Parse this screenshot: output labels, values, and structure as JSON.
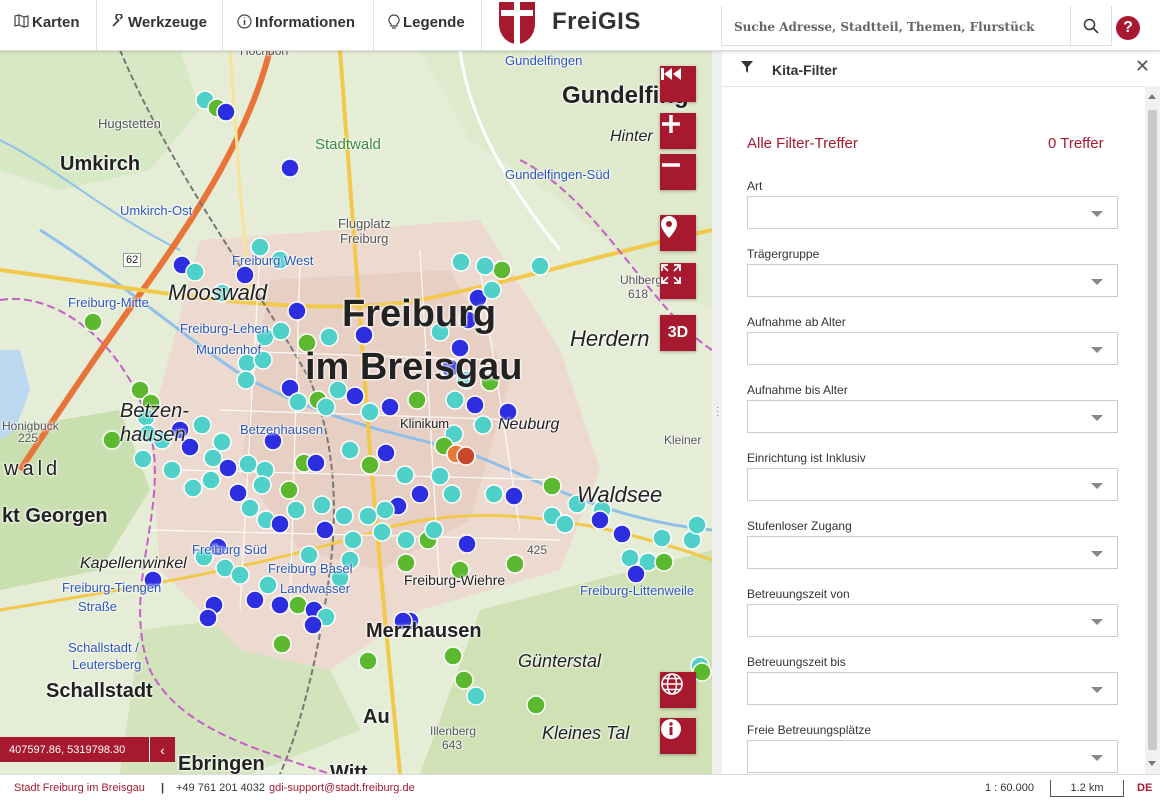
{
  "nav": {
    "karten": "Karten",
    "werkzeuge": "Werkzeuge",
    "informationen": "Informationen",
    "legende": "Legende",
    "app_title": "FreiGIS",
    "search_placeholder": "Suche Adresse, Stadtteil, Themen, Flurstück",
    "icons": {
      "karten": "map-icon",
      "werkzeuge": "wrench-icon",
      "informationen": "info-icon",
      "legende": "lightbulb-icon",
      "search": "search-icon",
      "help": "question-icon"
    }
  },
  "map": {
    "labels": {
      "hochdorf": "Hochdorf",
      "hugstetten": "Hugstetten",
      "umkirch": "Umkirch",
      "stadtwald": "Stadtwald",
      "umkirch_ost": "Umkirch-Ost",
      "flugplatz1": "Flugplatz",
      "flugplatz2": "Freiburg",
      "freiburg_west": "Freiburg West",
      "road62": "62",
      "freiburg_mitte": "Freiburg-Mitte",
      "mooswald": "Mooswald",
      "freiburg1": "Freiburg",
      "freiburg2": "im Breisgau",
      "herdern": "Herdern",
      "freiburg_lehen": "Freiburg-Lehen",
      "mundenhof": "Mundenhof",
      "betzen1": "Betzen-",
      "betzen2": "hausen",
      "betzenhausen": "Betzenhausen",
      "honigbuck": "Honigbuck",
      "h225": "225",
      "wald": "wald",
      "st_georgen": "kt Georgen",
      "kapellenwinkel": "Kapellenwinkel",
      "tiengen1": "Freiburg-Tiengen",
      "tiengen2": "Straße",
      "schallstadt_st1": "Schallstadt /",
      "schallstadt_st2": "Leutersberg",
      "schallstadt": "Schallstadt",
      "merzhausen": "Merzhausen",
      "au": "Au",
      "freiburg_wiehre": "Freiburg-Wiehre",
      "waldsee": "Waldsee",
      "guntersral": "Günterstal",
      "kleines_tal": "Kleines Tal",
      "illenberg": "Illenberg",
      "h643": "643",
      "gundelfingen_st": "Gundelfingen",
      "gundelfingen": "Gundelfing",
      "hinter": "Hinter",
      "gundelfingen_sud": "Gundelfingen-Süd",
      "uhlberg": "Uhlberg",
      "h618": "618",
      "kleiner": "Kleiner",
      "neuburg": "Neuburg",
      "ebringen": "Ebringen",
      "wittnau": "Witt",
      "freiburg_lw": "Freiburg-Littenweile",
      "freiburg_sud": "Freiburg Süd",
      "freiburg_basel": "Freiburg Basel",
      "landwasser": "Landwasser",
      "klinikum": "Klinikum",
      "h425": "425"
    },
    "controls": {
      "home": "rewind-icon",
      "zoom_in": "plus-icon",
      "zoom_out": "minus-icon",
      "locate": "location-pin-icon",
      "fullscreen": "fullscreen-icon",
      "three_d": "3D",
      "basemap": "globe-icon",
      "info": "info-icon"
    },
    "coords": "407597.86, 5319798.30",
    "colors": {
      "accent": "#a6192e",
      "teal": "#4fd1c9",
      "blue": "#2d2ee0",
      "green": "#5cb82f",
      "orange": "#e87a37"
    }
  },
  "panel": {
    "title": "Kita-Filter",
    "summary_label": "Alle Filter-Treffer",
    "summary_count": "0 Treffer",
    "fields": [
      {
        "label": "Art",
        "value": ""
      },
      {
        "label": "Trägergruppe",
        "value": ""
      },
      {
        "label": "Aufnahme ab Alter",
        "value": ""
      },
      {
        "label": "Aufnahme bis Alter",
        "value": ""
      },
      {
        "label": "Einrichtung ist Inklusiv",
        "value": ""
      },
      {
        "label": "Stufenloser Zugang",
        "value": ""
      },
      {
        "label": "Betreuungszeit von",
        "value": ""
      },
      {
        "label": "Betreuungszeit bis",
        "value": ""
      },
      {
        "label": "Freie Betreuungsplätze",
        "value": ""
      }
    ]
  },
  "footer": {
    "org": "Stadt Freiburg im Breisgau",
    "separator": "|",
    "phone": "+49 761 201 4032",
    "email": "gdi-support@stadt.freiburg.de",
    "scale": "1 : 60.000",
    "scale_bar": "1.2 km",
    "lang": "DE"
  }
}
